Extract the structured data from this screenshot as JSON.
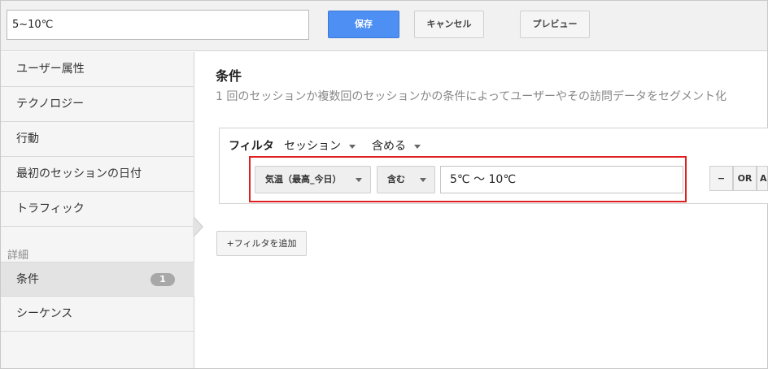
{
  "header": {
    "segment_name": "5~10℃",
    "save_label": "保存",
    "cancel_label": "キャンセル",
    "preview_label": "プレビュー"
  },
  "sidebar": {
    "items": [
      {
        "label": "ユーザー属性"
      },
      {
        "label": "テクノロジー"
      },
      {
        "label": "行動"
      },
      {
        "label": "最初のセッションの日付"
      },
      {
        "label": "トラフィック"
      }
    ],
    "section_label": "詳細",
    "advanced": [
      {
        "label": "条件",
        "badge": "1"
      },
      {
        "label": "シーケンス"
      }
    ]
  },
  "main": {
    "title": "条件",
    "description": "1 回のセッションか複数回のセッションかの条件によってユーザーやその訪問データをセグメント化",
    "filter": {
      "label": "フィルタ",
      "scope": "セッション",
      "mode": "含める",
      "dimension": "気温（最高_今日）",
      "operator": "含む",
      "value": "5℃ 〜 10℃",
      "minus_label": "−",
      "or_label": "OR",
      "and_label": "AND"
    },
    "add_filter_label": "+フィルタを追加"
  }
}
